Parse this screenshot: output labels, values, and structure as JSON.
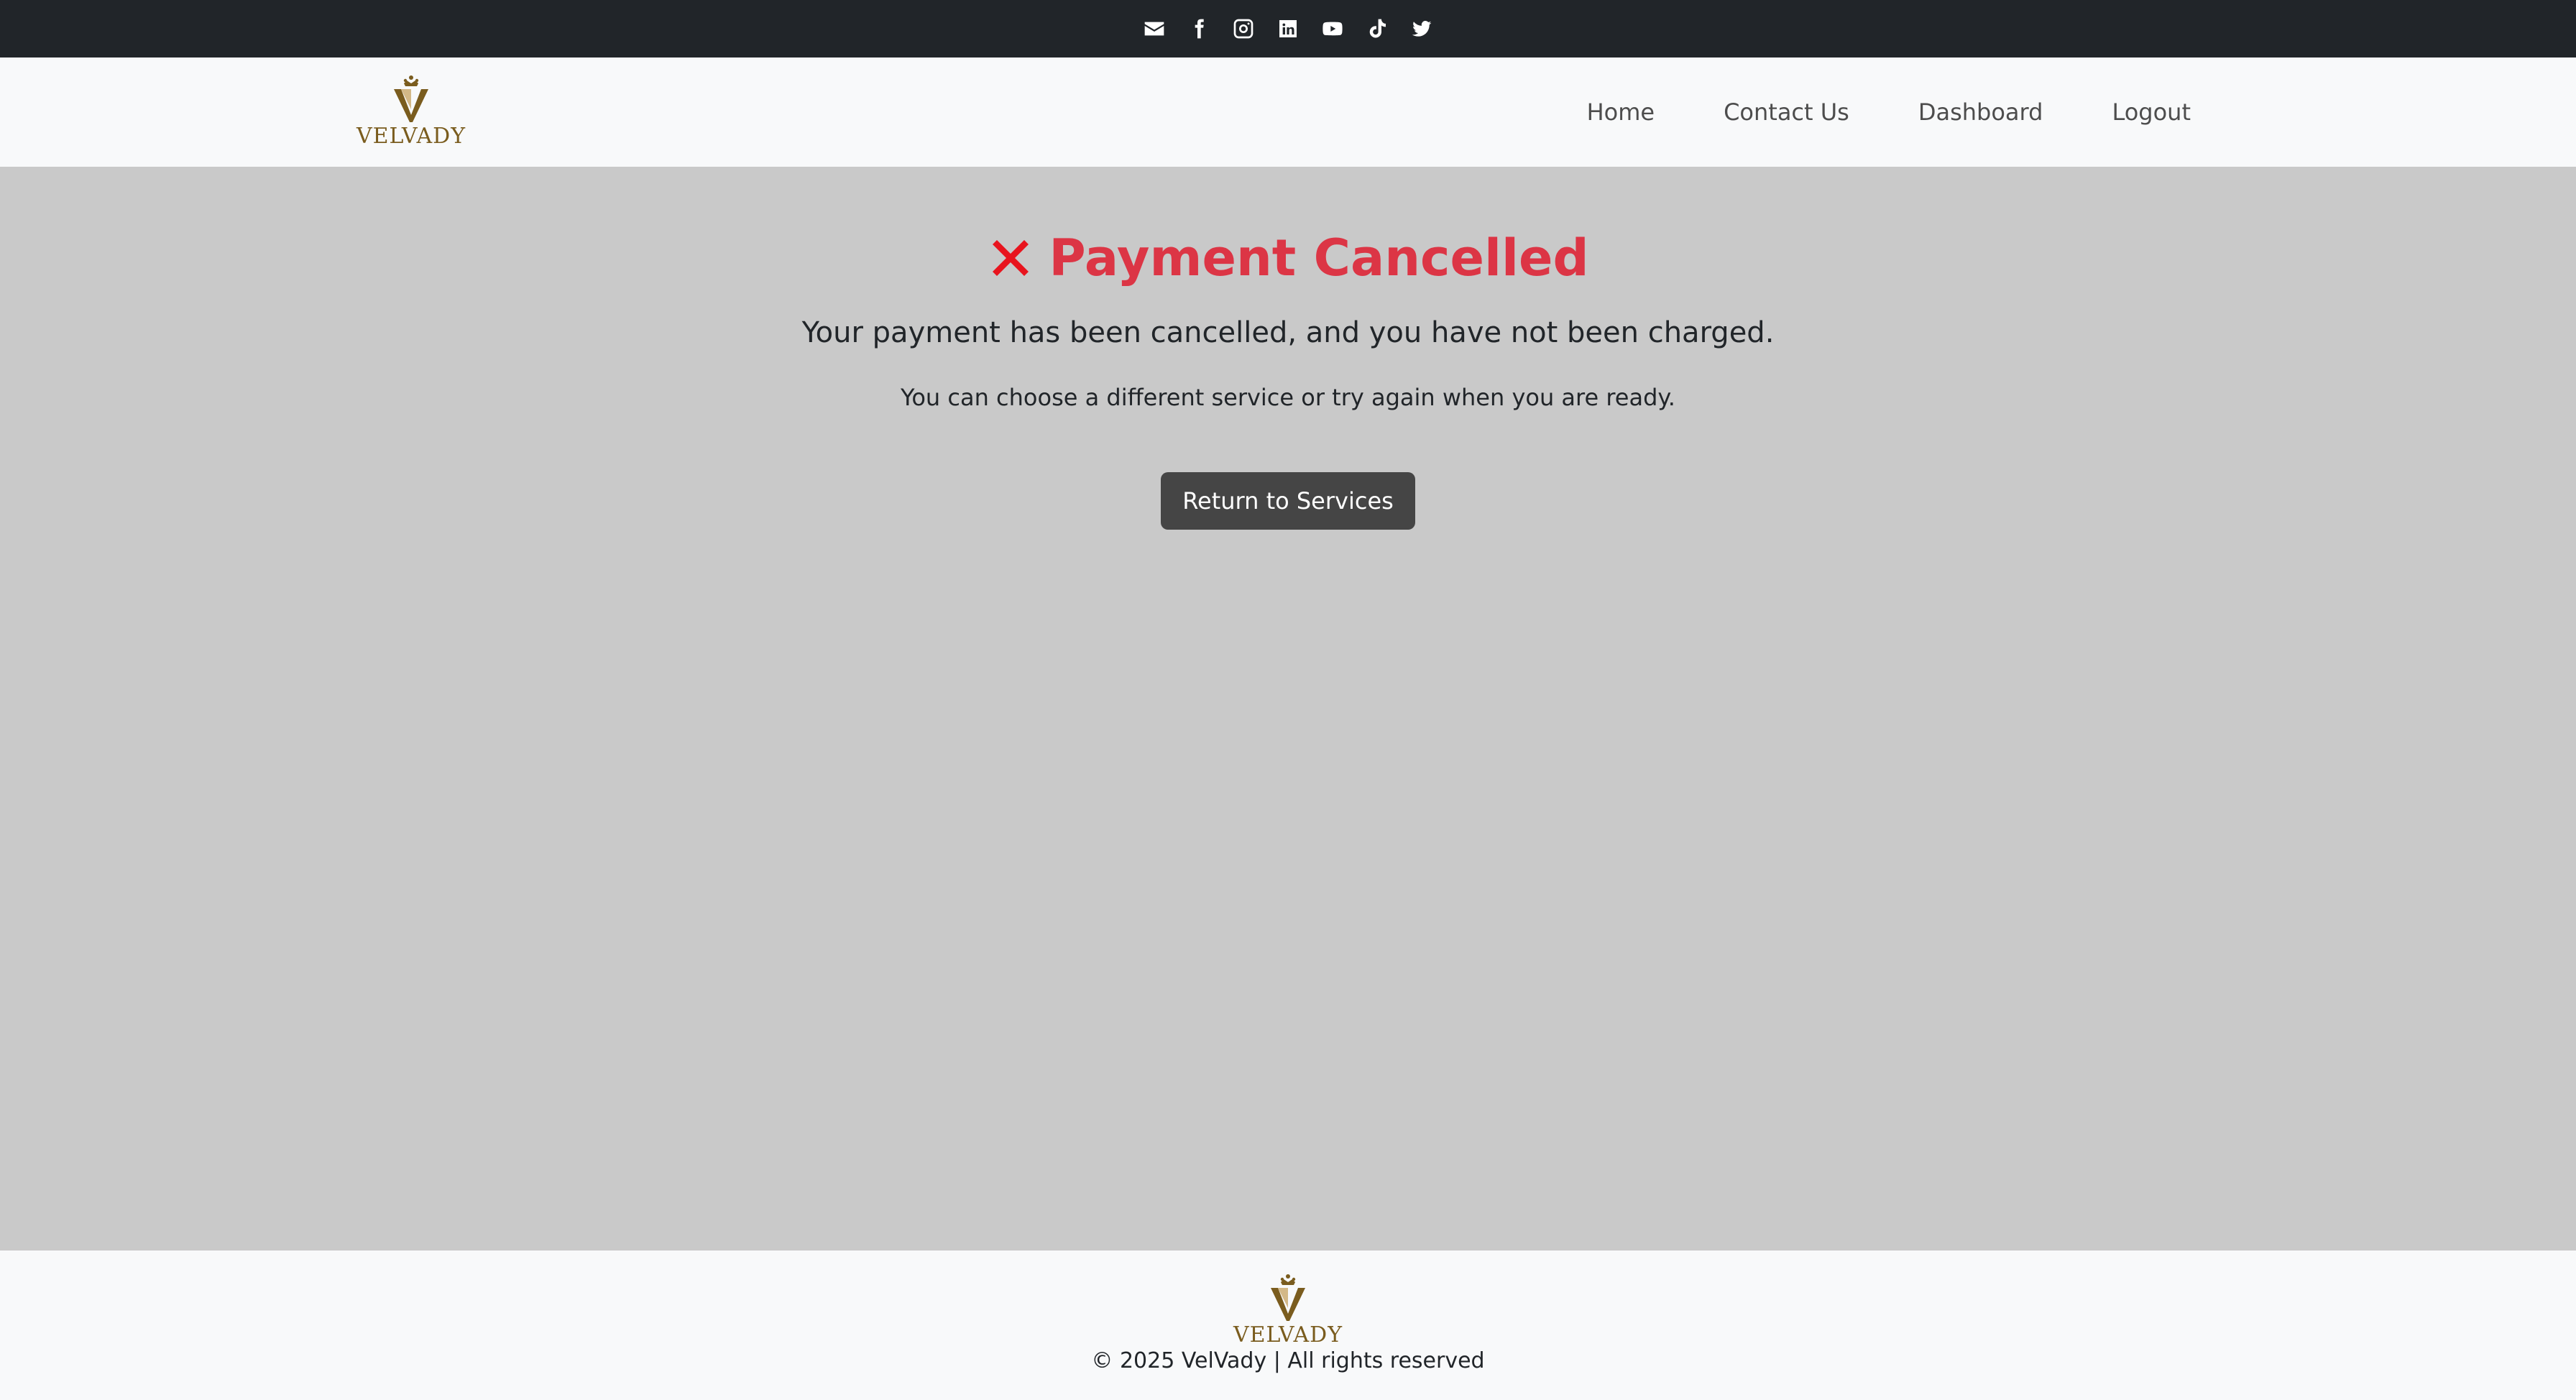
{
  "social": {
    "icons": [
      "envelope-icon",
      "facebook-icon",
      "instagram-icon",
      "linkedin-icon",
      "youtube-icon",
      "tiktok-icon",
      "twitter-icon"
    ]
  },
  "brand": {
    "name": "VELVADY",
    "logo_color": "#7a5c1e"
  },
  "nav": {
    "items": [
      {
        "label": "Home"
      },
      {
        "label": "Contact Us"
      },
      {
        "label": "Dashboard"
      },
      {
        "label": "Logout"
      }
    ]
  },
  "main": {
    "icon": "cross-mark-icon",
    "title": "Payment Cancelled",
    "lead": "Your payment has been cancelled, and you have not been charged.",
    "sub": "You can choose a different service or try again when you are ready.",
    "button_label": "Return to Services"
  },
  "footer": {
    "brand_name": "VELVADY",
    "copyright": "© 2025 VelVady | All rights reserved"
  },
  "colors": {
    "topbar_bg": "#212529",
    "nav_bg": "#f8f9fa",
    "main_bg": "#c9c9c9",
    "title_red": "#dc3545",
    "button_bg": "#454545"
  }
}
